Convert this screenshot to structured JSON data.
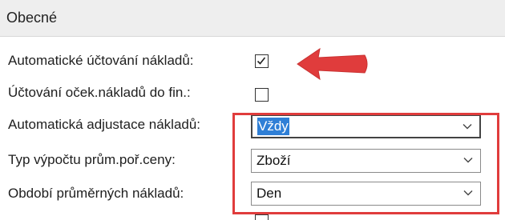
{
  "section": {
    "title": "Obecné"
  },
  "fields": {
    "auto_posting": {
      "label": "Automatické účtování nákladů:",
      "checked": true
    },
    "expected_cost_posting": {
      "label": "Účtování oček.nákladů do fin.:",
      "checked": false
    },
    "auto_adjustment": {
      "label": "Automatická adjustace nákladů:",
      "value": "Vždy"
    },
    "avg_cost_calc_type": {
      "label": "Typ výpočtu prům.poř.ceny:",
      "value": "Zboží"
    },
    "avg_cost_period": {
      "label": "Období průměrných nákladů:",
      "value": "Den"
    }
  },
  "annotation": {
    "color": "#e03c3c"
  }
}
